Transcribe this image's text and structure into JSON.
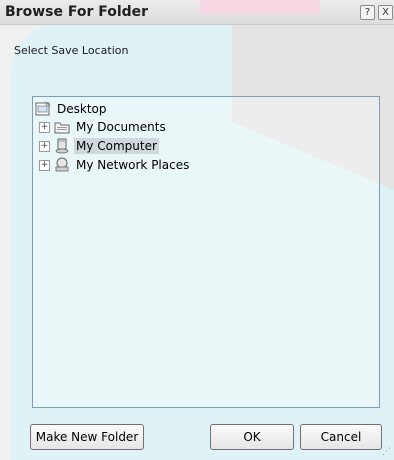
{
  "window": {
    "title": "Browse For Folder"
  },
  "titlebar": {
    "help_label": "?",
    "close_label": "X"
  },
  "dialog": {
    "prompt": "Select Save Location"
  },
  "tree": {
    "root": {
      "label": "Desktop",
      "icon": "desktop-icon"
    },
    "children": [
      {
        "label": "My Documents",
        "icon": "folder-icon",
        "expander": "+"
      },
      {
        "label": "My Computer",
        "icon": "computer-icon",
        "expander": "+",
        "selected": true
      },
      {
        "label": "My Network Places",
        "icon": "network-icon",
        "expander": "+"
      }
    ]
  },
  "buttons": {
    "make_new_folder": "Make New Folder",
    "ok": "OK",
    "cancel": "Cancel"
  },
  "colors": {
    "tree_border": "#7f9db9",
    "selection": "#cfd8dc",
    "background_tint": "#dff3f6"
  }
}
